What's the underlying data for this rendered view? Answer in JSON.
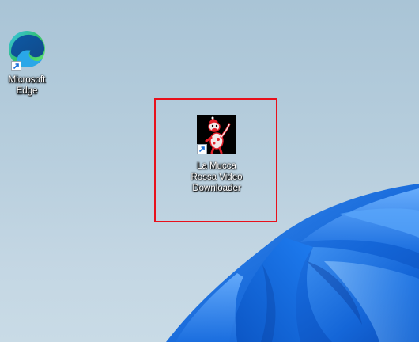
{
  "desktop": {
    "icons": [
      {
        "id": "microsoft-edge",
        "label": "Microsoft\nEdge",
        "icon": "edge-browser-icon",
        "shortcut": true
      },
      {
        "id": "la-mucca-rossa",
        "label": "La Mucca\nRossa Video\nDownloader",
        "icon": "red-cow-icon",
        "shortcut": true
      }
    ]
  },
  "colors": {
    "highlight": "#e8101b",
    "wallpaper_bg": "#b7cedd",
    "bloom_blue": "#1e78e6",
    "icon_bg": "#000000",
    "cow_red": "#e4202a"
  }
}
